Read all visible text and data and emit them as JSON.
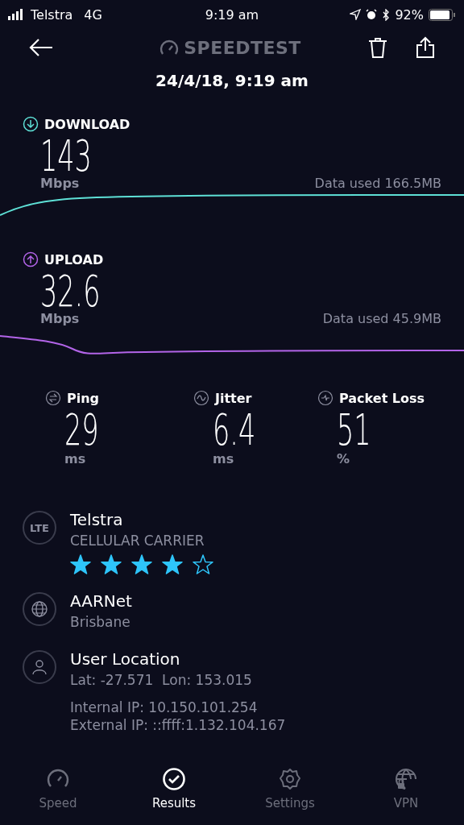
{
  "status_bar": {
    "carrier": "Telstra",
    "network": "4G",
    "time": "9:19 am",
    "battery": "92%"
  },
  "header": {
    "logo": "SPEEDTEST",
    "date": "24/4/18, 9:19 am"
  },
  "transfers": [
    {
      "kind": "download",
      "label": "DOWNLOAD",
      "value": "143",
      "unit": "Mbps",
      "data_used": "Data used 166.5MB",
      "color": "#5ee0d6"
    },
    {
      "kind": "upload",
      "label": "UPLOAD",
      "value": "32.6",
      "unit": "Mbps",
      "data_used": "Data used 45.9MB",
      "color": "#b364e8"
    }
  ],
  "metrics": [
    {
      "kind": "ping",
      "label": "Ping",
      "value": "29",
      "unit": "ms"
    },
    {
      "kind": "jitter",
      "label": "Jitter",
      "value": "6.4",
      "unit": "ms"
    },
    {
      "kind": "loss",
      "label": "Packet Loss",
      "value": "51",
      "unit": "%"
    }
  ],
  "carrier": {
    "badge": "LTE",
    "name": "Telstra",
    "subtitle": "CELLULAR CARRIER",
    "stars": 4
  },
  "server": {
    "name": "AARNet",
    "city": "Brisbane"
  },
  "location": {
    "title": "User Location",
    "coords": "Lat: -27.571  Lon: 153.015",
    "internal_ip": "Internal IP: 10.150.101.254",
    "external_ip": "External IP: ::ffff:1.132.104.167"
  },
  "tabs": [
    {
      "kind": "speed",
      "label": "Speed",
      "selected": false
    },
    {
      "kind": "results",
      "label": "Results",
      "selected": true
    },
    {
      "kind": "settings",
      "label": "Settings",
      "selected": false
    },
    {
      "kind": "vpn",
      "label": "VPN",
      "selected": false
    }
  ]
}
